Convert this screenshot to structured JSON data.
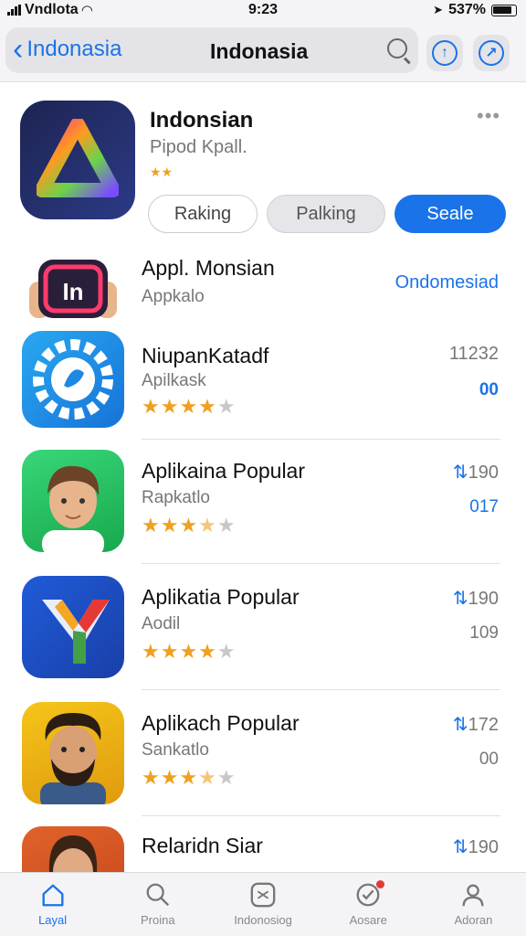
{
  "status_bar": {
    "carrier": "Vndlota",
    "time": "9:23",
    "battery": "537%"
  },
  "nav": {
    "back_label": "Indonasia",
    "title": "Indonasia"
  },
  "featured": {
    "title": "Indonsian",
    "subtitle": "Pipod Kpall.",
    "rating": "★★",
    "more": "•••",
    "buttons": {
      "b1": "Raking",
      "b2": "Palking",
      "b3": "Seale"
    }
  },
  "apps": [
    {
      "name": "Appl. Monsian",
      "category": "Appkalo",
      "value1": "Ondomesiad",
      "value2": "",
      "stars": 0
    },
    {
      "name": "NiupanKatadf",
      "category": "Apilkask",
      "value1": "11232",
      "value2": "00",
      "stars": 4
    },
    {
      "name": "Aplikaina Popular",
      "category": "Rapkatlo",
      "value1": "190",
      "value2": "017",
      "stars": 3.5
    },
    {
      "name": "Aplikatia Popular",
      "category": "Aodil",
      "value1": "190",
      "value2": "109",
      "stars": 4
    },
    {
      "name": "Aplikach Popular",
      "category": "Sankatlo",
      "value1": "172",
      "value2": "00",
      "stars": 3.5
    },
    {
      "name": "Relaridn Siar",
      "category": "",
      "value1": "190",
      "value2": "",
      "stars": 0
    }
  ],
  "tabs": [
    {
      "label": "Layal"
    },
    {
      "label": "Proina"
    },
    {
      "label": "Indonosiog"
    },
    {
      "label": "Aosare"
    },
    {
      "label": "Adoran"
    }
  ],
  "colors": {
    "accent": "#1a73e8",
    "star": "#f0a020",
    "badge": "#e53935"
  }
}
